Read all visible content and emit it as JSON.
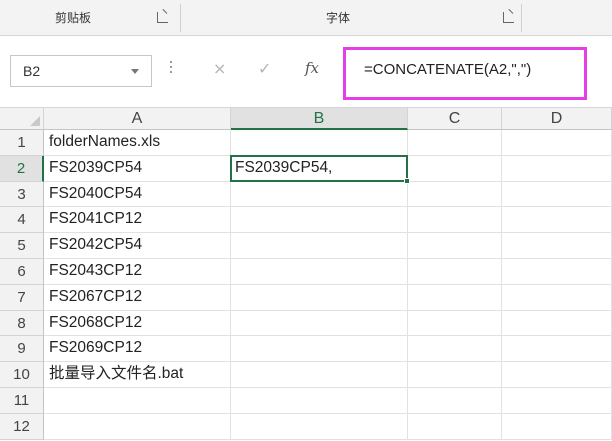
{
  "ribbon": {
    "groups": [
      {
        "label": "剪贴板",
        "launcher_icon": "dialog-launcher-icon"
      },
      {
        "label": "字体",
        "launcher_icon": "dialog-launcher-icon"
      }
    ]
  },
  "formula_bar": {
    "name_box": "B2",
    "cancel_icon": "×",
    "enter_icon": "✓",
    "fx_label": "fx",
    "formula": "=CONCATENATE(A2,\",\")",
    "highlight_color": "#e63ee6"
  },
  "grid": {
    "columns": [
      "A",
      "B",
      "C",
      "D"
    ],
    "active_column": "B",
    "rows": [
      {
        "num": "1",
        "A": "folderNames.xls",
        "B": ""
      },
      {
        "num": "2",
        "A": "FS2039CP54",
        "B": "FS2039CP54,"
      },
      {
        "num": "3",
        "A": "FS2040CP54",
        "B": ""
      },
      {
        "num": "4",
        "A": "FS2041CP12",
        "B": ""
      },
      {
        "num": "5",
        "A": "FS2042CP54",
        "B": ""
      },
      {
        "num": "6",
        "A": "FS2043CP12",
        "B": ""
      },
      {
        "num": "7",
        "A": "FS2067CP12",
        "B": ""
      },
      {
        "num": "8",
        "A": "FS2068CP12",
        "B": ""
      },
      {
        "num": "9",
        "A": "FS2069CP12",
        "B": ""
      },
      {
        "num": "10",
        "A": "批量导入文件名.bat",
        "B": ""
      },
      {
        "num": "11",
        "A": "",
        "B": ""
      },
      {
        "num": "12",
        "A": "",
        "B": ""
      }
    ],
    "active_cell": "B2",
    "accent_color": "#217346"
  }
}
